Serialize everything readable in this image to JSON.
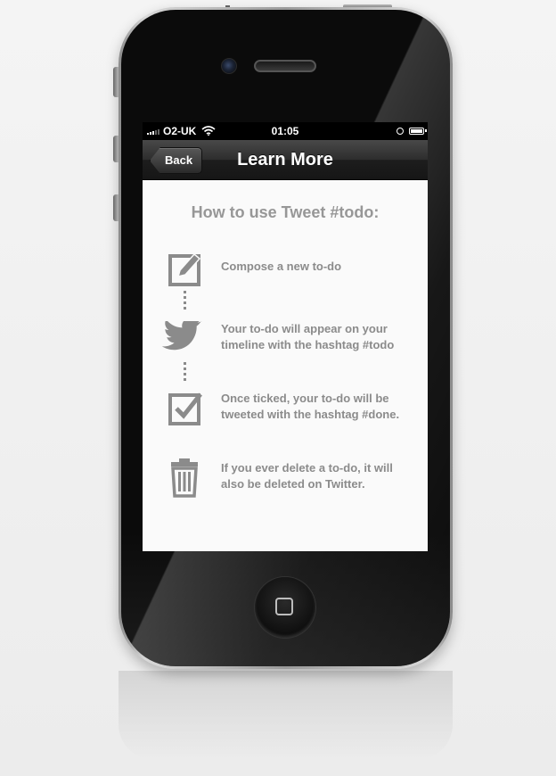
{
  "statusbar": {
    "carrier": "O2-UK",
    "time": "01:05"
  },
  "navbar": {
    "back_label": "Back",
    "title": "Learn More"
  },
  "content": {
    "heading": "How to use Tweet #todo:",
    "steps": [
      {
        "icon": "compose-icon",
        "text": "Compose a new to-do"
      },
      {
        "icon": "twitter-bird-icon",
        "text": "Your to-do will appear on your timeline with the hashtag #todo"
      },
      {
        "icon": "checkbox-icon",
        "text": "Once ticked, your to-do will be tweeted with the hashtag #done."
      },
      {
        "icon": "trash-icon",
        "text": "If you ever delete a to-do, it will also be deleted on Twitter."
      }
    ]
  },
  "colors": {
    "text_gray": "#8b8b8b",
    "heading_gray": "#979797",
    "navbar_dark": "#1d1d1d",
    "screen_bg": "#fafafa"
  }
}
